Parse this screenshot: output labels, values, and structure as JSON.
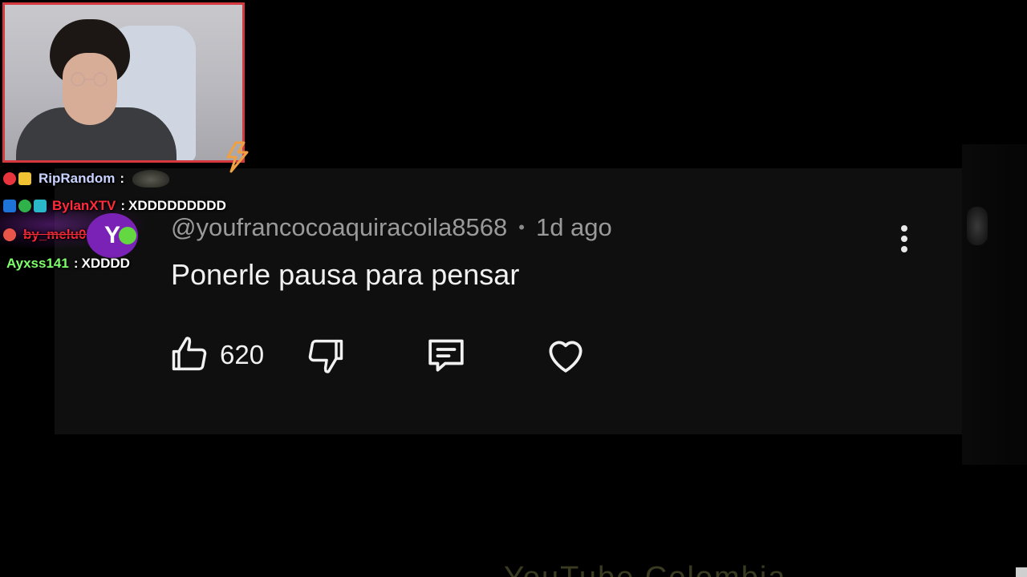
{
  "comment": {
    "author": "@youfrancocoaquiracoila8568",
    "separator": "•",
    "time_ago": "1d ago",
    "text": "Ponerle pausa para pensar",
    "like_count": "620"
  },
  "icons": {
    "like": "thumbs-up-icon",
    "dislike": "thumbs-down-icon",
    "reply": "comment-icon",
    "heart": "heart-icon",
    "more": "more-vertical-icon"
  },
  "chat": {
    "messages": [
      {
        "user": "RipRandom",
        "separator": ":",
        "message": "",
        "user_color": "#c9d3ff"
      },
      {
        "user": "BylanXTV",
        "separator": ":",
        "message": "XDDDDDDDDD",
        "user_color": "#ff2a3a"
      },
      {
        "user": "by_melu05",
        "separator": ":",
        "message": "",
        "user_color": "#ff2a3a"
      },
      {
        "user": "Ayxss141",
        "separator": ":",
        "message": "XDDDD",
        "user_color": "#7dff6a"
      }
    ]
  },
  "overlay": {
    "y_badge": "Y",
    "watermark": "YouTube Colombia"
  },
  "colors": {
    "webcam_border": "#d3393f",
    "card_bg": "#0f0f0f",
    "text_primary": "#f1f1f1",
    "text_secondary": "#9a9a9a"
  }
}
